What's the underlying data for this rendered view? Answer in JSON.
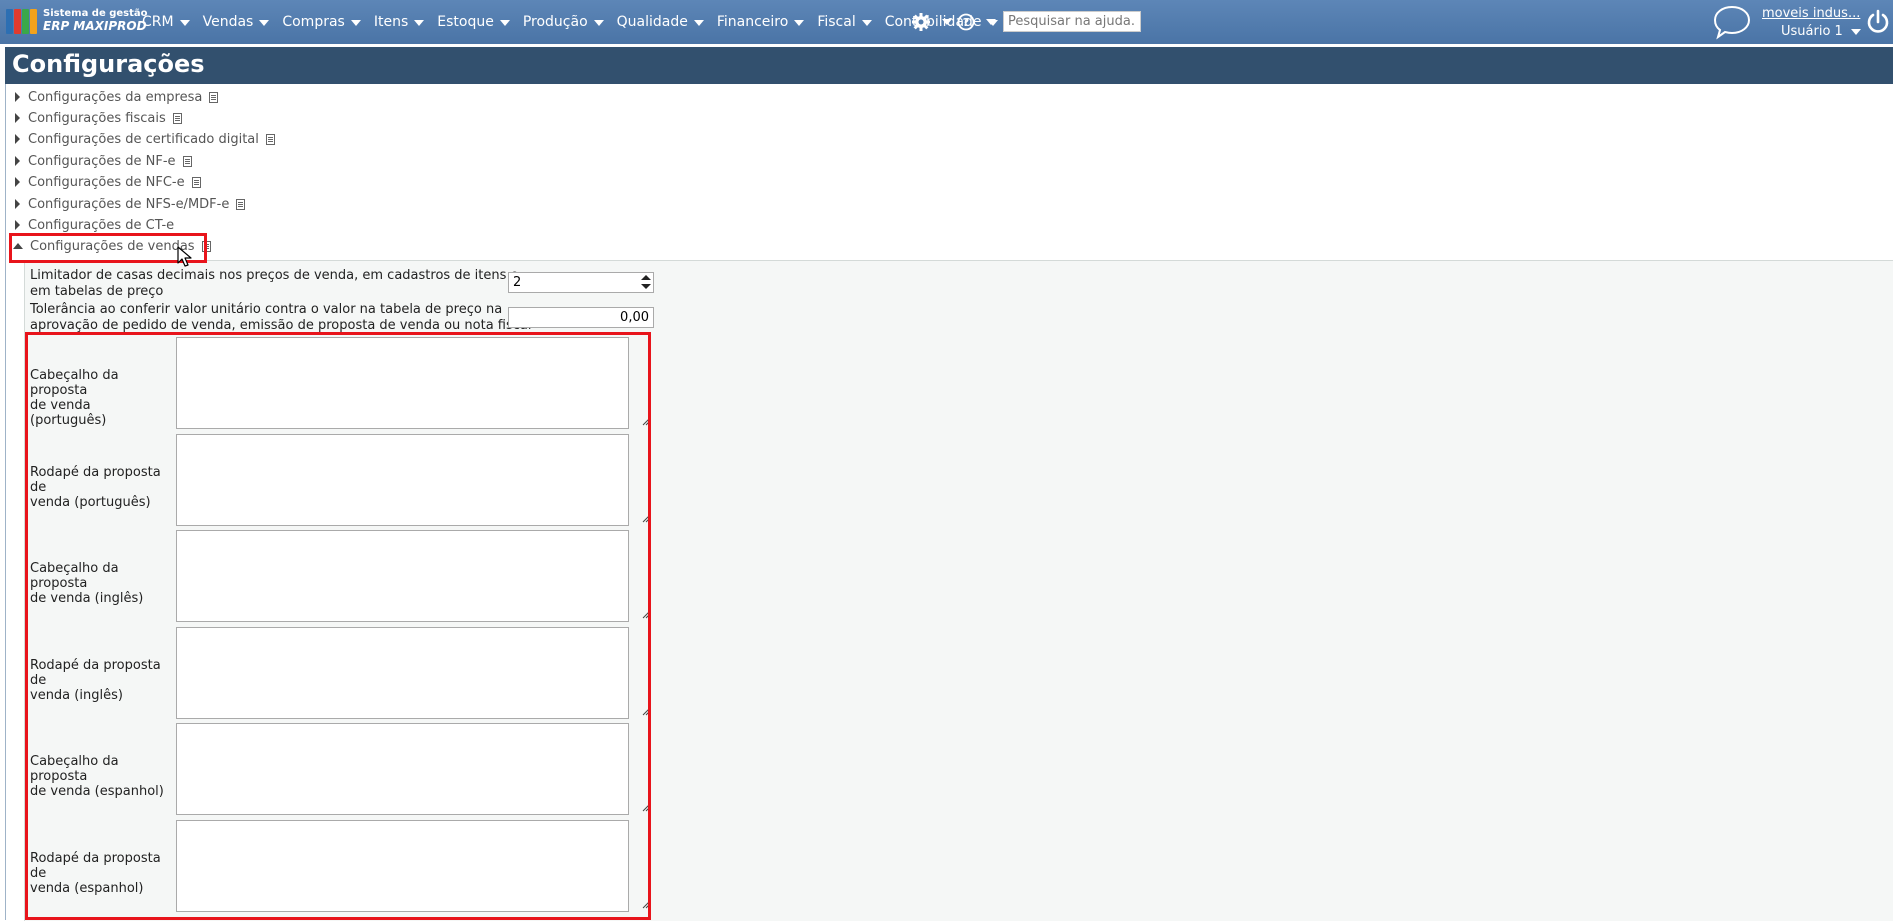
{
  "app": {
    "brand_line1": "Sistema de gestão",
    "brand_line2": "ERP MAXIPROD",
    "logo_colors": [
      "#2c6fb3",
      "#e03b2f",
      "#3aa84a",
      "#f2a21b"
    ]
  },
  "nav": {
    "items": [
      {
        "label": "CRM"
      },
      {
        "label": "Vendas"
      },
      {
        "label": "Compras"
      },
      {
        "label": "Itens"
      },
      {
        "label": "Estoque"
      },
      {
        "label": "Produção"
      },
      {
        "label": "Qualidade"
      },
      {
        "label": "Financeiro"
      },
      {
        "label": "Fiscal"
      },
      {
        "label": "Contabilidade"
      }
    ],
    "search_placeholder": "Pesquisar na ajuda...",
    "icons": [
      "gear-icon",
      "help-icon",
      "chat-icon",
      "power-icon"
    ]
  },
  "user": {
    "company": "moveis indus...",
    "name": "Usuário 1"
  },
  "page": {
    "title": "Configurações"
  },
  "tree": {
    "items": [
      {
        "label": "Configurações da empresa",
        "expanded": false,
        "has_doc_icon": true
      },
      {
        "label": "Configurações fiscais",
        "expanded": false,
        "has_doc_icon": true
      },
      {
        "label": "Configurações de certificado digital",
        "expanded": false,
        "has_doc_icon": true
      },
      {
        "label": "Configurações de NF-e",
        "expanded": false,
        "has_doc_icon": true
      },
      {
        "label": "Configurações de NFC-e",
        "expanded": false,
        "has_doc_icon": true
      },
      {
        "label": "Configurações de NFS-e/MDF-e",
        "expanded": false,
        "has_doc_icon": true
      },
      {
        "label": "Configurações de CT-e",
        "expanded": false,
        "has_doc_icon": false
      },
      {
        "label": "Configurações de vendas",
        "expanded": true,
        "has_doc_icon": true
      }
    ]
  },
  "sales_settings": {
    "decimal_limit": {
      "label_line1": "Limitador de casas decimais nos preços de venda, em cadastros de itens e",
      "label_line2": "em tabelas de preço",
      "value": "2"
    },
    "tolerance": {
      "label_line1": "Tolerância ao conferir valor unitário contra o valor na tabela de preço na",
      "label_line2": "aprovação de pedido de venda, emissão de proposta de venda ou nota fiscal",
      "value": "0,00"
    },
    "textareas": [
      {
        "line1": "Cabeçalho da proposta",
        "line2": "de venda (português)",
        "value": ""
      },
      {
        "line1": "Rodapé da proposta de",
        "line2": "venda (português)",
        "value": ""
      },
      {
        "line1": "Cabeçalho da proposta",
        "line2": "de venda (inglês)",
        "value": ""
      },
      {
        "line1": "Rodapé da proposta de",
        "line2": "venda (inglês)",
        "value": ""
      },
      {
        "line1": "Cabeçalho da proposta",
        "line2": "de venda (espanhol)",
        "value": ""
      },
      {
        "line1": "Rodapé da proposta de",
        "line2": "venda (espanhol)",
        "value": ""
      }
    ]
  },
  "colors": {
    "topbar": "#527cad",
    "header": "#32506e",
    "highlight": "#e8141b"
  }
}
